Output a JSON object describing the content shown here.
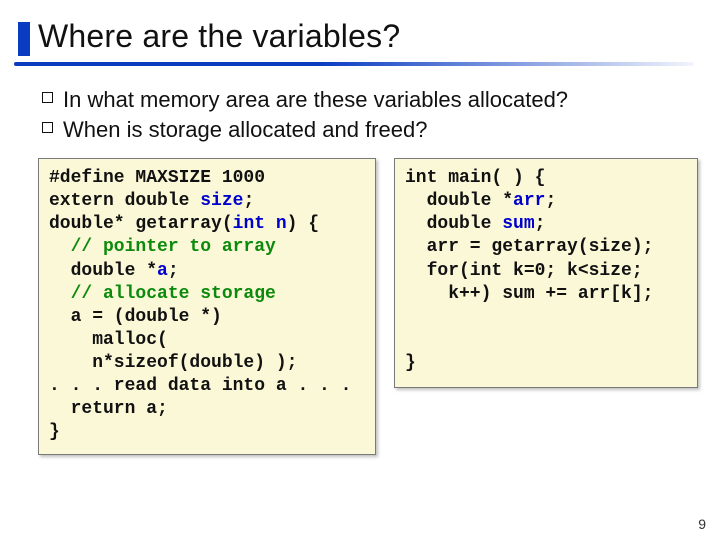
{
  "slide": {
    "title": "Where are the variables?",
    "bullets": [
      "In what memory area are these variables allocated?",
      "When is storage allocated and freed?"
    ],
    "page_number": "9"
  },
  "code_left": {
    "l1a": "#define MAXSIZE 1000",
    "l2a": "extern double ",
    "l2b": "size",
    "l2c": ";",
    "l3a": "double* getarray(",
    "l3b": "int n",
    "l3c": ") {",
    "l4a": "  // pointer to array",
    "l5a": "  double *",
    "l5b": "a",
    "l5c": ";",
    "l6a": "  // allocate storage",
    "l7a": "  a = (double *)",
    "l8a": "    malloc(",
    "l9a": "    n*sizeof(double) );",
    "l10a": ". . . read data into a . . .",
    "l11a": "  return a;",
    "l12a": "}"
  },
  "code_right": {
    "l1a": "int main( ) {",
    "l2a": "  double *",
    "l2b": "arr",
    "l2c": ";",
    "l3a": "  double ",
    "l3b": "sum",
    "l3c": ";",
    "l4a": "  arr = getarray(size);",
    "l5a": "  for(int k=0; k<size;",
    "l6a": "    k++) sum += arr[k];",
    "l7a": "",
    "l8a": "",
    "l9a": "}"
  }
}
